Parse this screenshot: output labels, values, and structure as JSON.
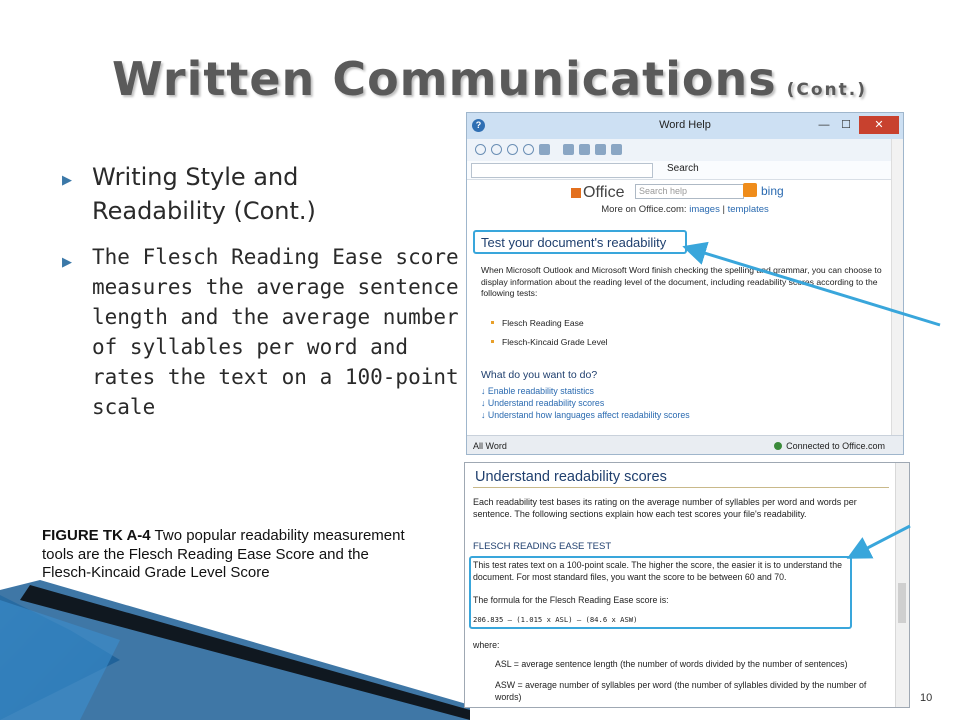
{
  "slide": {
    "title": "Written Communications",
    "title_suffix": "(Cont.)",
    "bullets": [
      {
        "text": "Writing Style and Readability (Cont.)"
      },
      {
        "text": "The Flesch Reading Ease score measures the average sentence length and the average number of syllables per word and rates the text on a 100-point scale"
      }
    ],
    "caption_label": "FIGURE TK A-4",
    "caption_text": " Two popular readability measurement tools are the Flesch Reading Ease Score and the Flesch-Kincaid Grade Level Score",
    "page_number": "10",
    "accent_color": "#39a6db"
  },
  "word_help": {
    "window_title": "Word Help",
    "help_glyph": "?",
    "min_glyph": "—",
    "max_glyph": "☐",
    "close_glyph": "✕",
    "search_label": "Search",
    "office_logo": "Office",
    "search_placeholder": "Search help",
    "bing": "bing",
    "more_on": "More on Office.com:",
    "link_images": "images",
    "link_sep": " | ",
    "link_templates": "templates",
    "section_title": "Test your document's readability",
    "paragraph": "When Microsoft Outlook and Microsoft Word finish checking the spelling and grammar, you can choose to display information about the reading level of the document, including readability scores according to the following tests:",
    "tests": [
      "Flesch Reading Ease",
      "Flesch-Kincaid Grade Level"
    ],
    "what_do": "What do you want to do?",
    "links": [
      "Enable readability statistics",
      "Understand readability scores",
      "Understand how languages affect readability scores"
    ],
    "status_left": "All Word",
    "status_right": "Connected to Office.com"
  },
  "readability_scores": {
    "heading": "Understand readability scores",
    "intro": "Each readability test bases its rating on the average number of syllables per word and words per sentence. The following sections explain how each test scores your file's readability.",
    "subheading": "FLESCH READING EASE TEST",
    "box_text": "This test rates text on a 100-point scale. The higher the score, the easier it is to understand the document. For most standard files, you want the score to be between 60 and 70.",
    "formula_intro": "The formula for the Flesch Reading Ease score is:",
    "formula": "206.835 – (1.015 x ASL) – (84.6 x ASW)",
    "where": "where:",
    "asl": "ASL = average sentence length (the number of words divided by the number of sentences)",
    "asw": "ASW = average number of syllables per word (the number of syllables divided by the number of words)"
  }
}
